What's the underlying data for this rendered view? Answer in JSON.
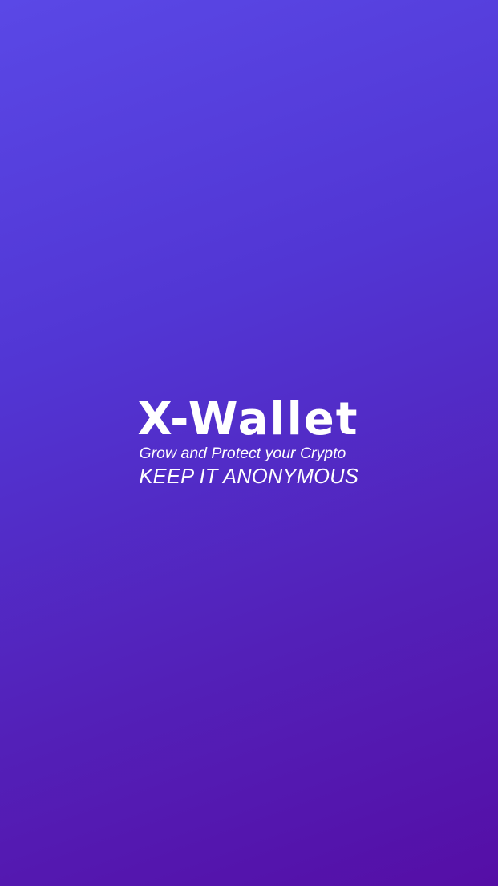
{
  "app": {
    "name": "X-Wallet",
    "tagline": "Grow and Protect your Crypto",
    "motto": "KEEP IT ANONYMOUS"
  },
  "colors": {
    "gradient_top": "#5a48e6",
    "gradient_bottom": "#550ea6",
    "text": "#ffffff"
  }
}
